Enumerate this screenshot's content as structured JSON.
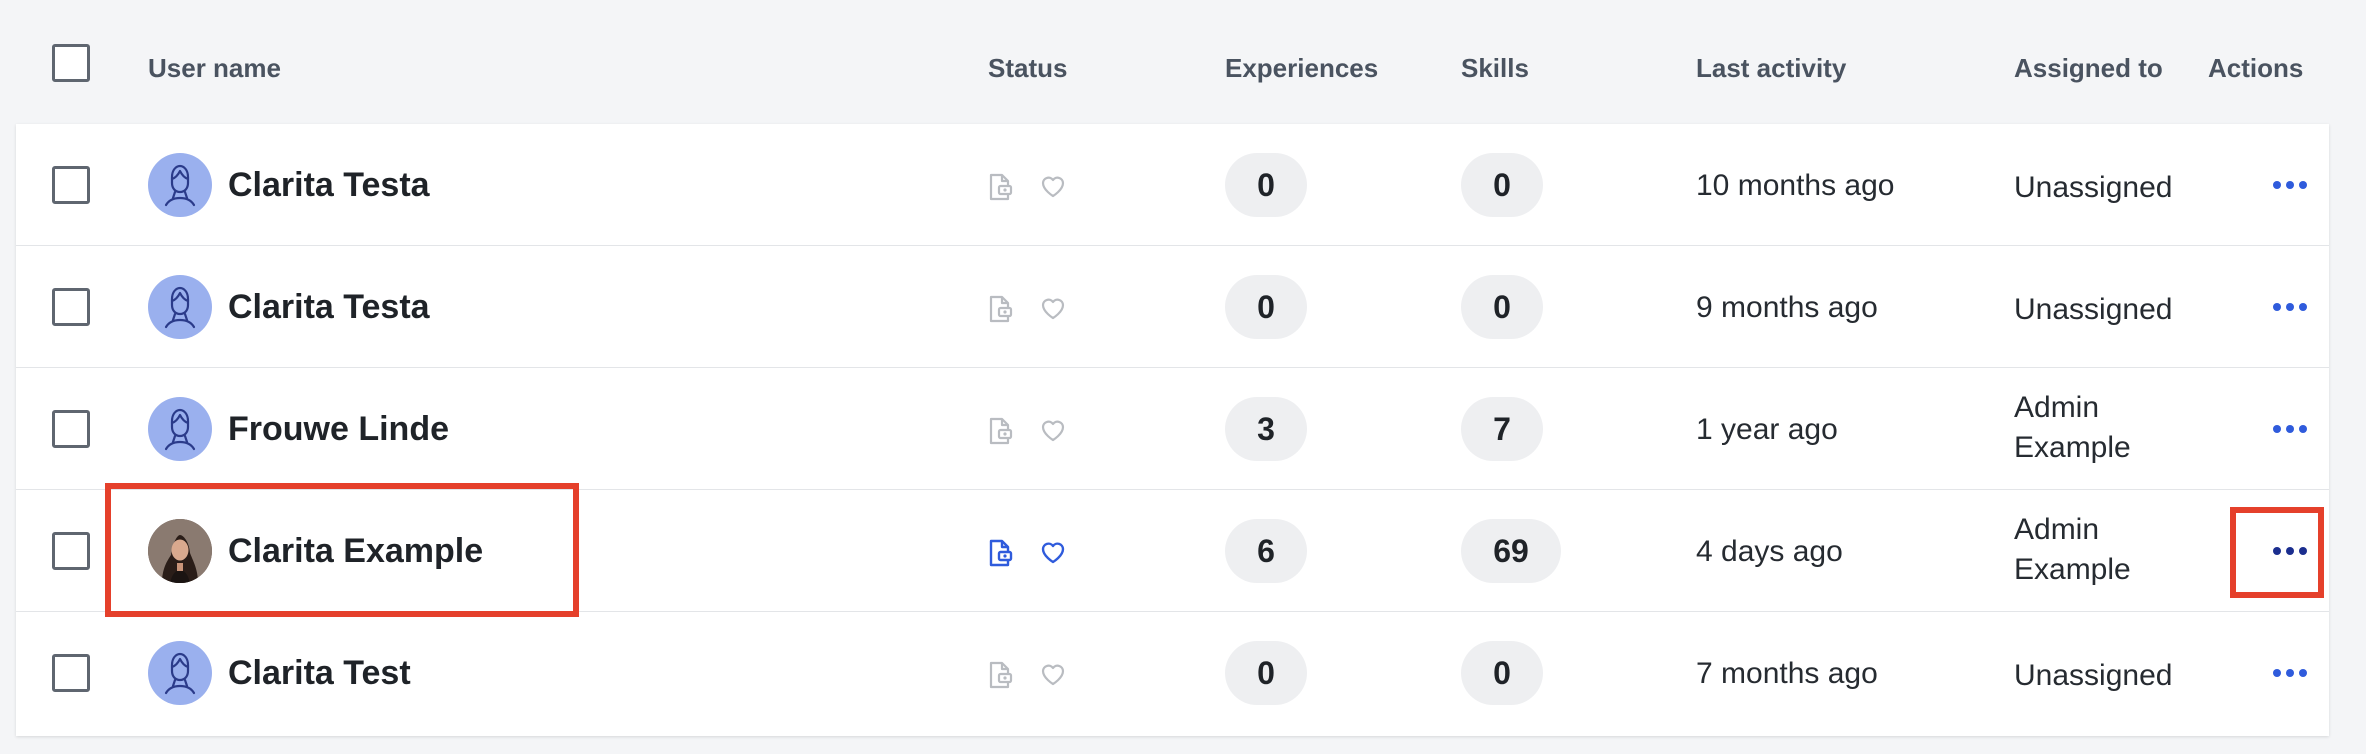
{
  "header": {
    "user_name": "User name",
    "status": "Status",
    "experiences": "Experiences",
    "skills": "Skills",
    "last_activity": "Last activity",
    "assigned_to": "Assigned to",
    "actions": "Actions"
  },
  "rows": [
    {
      "name": "Clarita Testa",
      "experiences": "0",
      "skills": "0",
      "last_activity": "10 months ago",
      "assigned": "Unassigned",
      "status_active": false,
      "avatar": "avatar-placeholder-icon"
    },
    {
      "name": "Clarita Testa",
      "experiences": "0",
      "skills": "0",
      "last_activity": "9 months ago",
      "assigned": "Unassigned",
      "status_active": false,
      "avatar": "avatar-placeholder-icon"
    },
    {
      "name": "Frouwe Linde",
      "experiences": "3",
      "skills": "7",
      "last_activity": "1 year ago",
      "assigned": "Admin Example",
      "status_active": false,
      "avatar": "avatar-placeholder-icon"
    },
    {
      "name": "Clarita Example",
      "experiences": "6",
      "skills": "69",
      "last_activity": "4 days ago",
      "assigned": "Admin Example",
      "status_active": true,
      "avatar": "profile-photo"
    },
    {
      "name": "Clarita Test",
      "experiences": "0",
      "skills": "0",
      "last_activity": "7 months ago",
      "assigned": "Unassigned",
      "status_active": false,
      "avatar": "avatar-placeholder-icon"
    }
  ],
  "colors": {
    "accent": "#2f5bdc",
    "highlight": "#e5402b",
    "avatar_bg": "#9ab0ee",
    "status_inactive": "#b9bcc1"
  }
}
